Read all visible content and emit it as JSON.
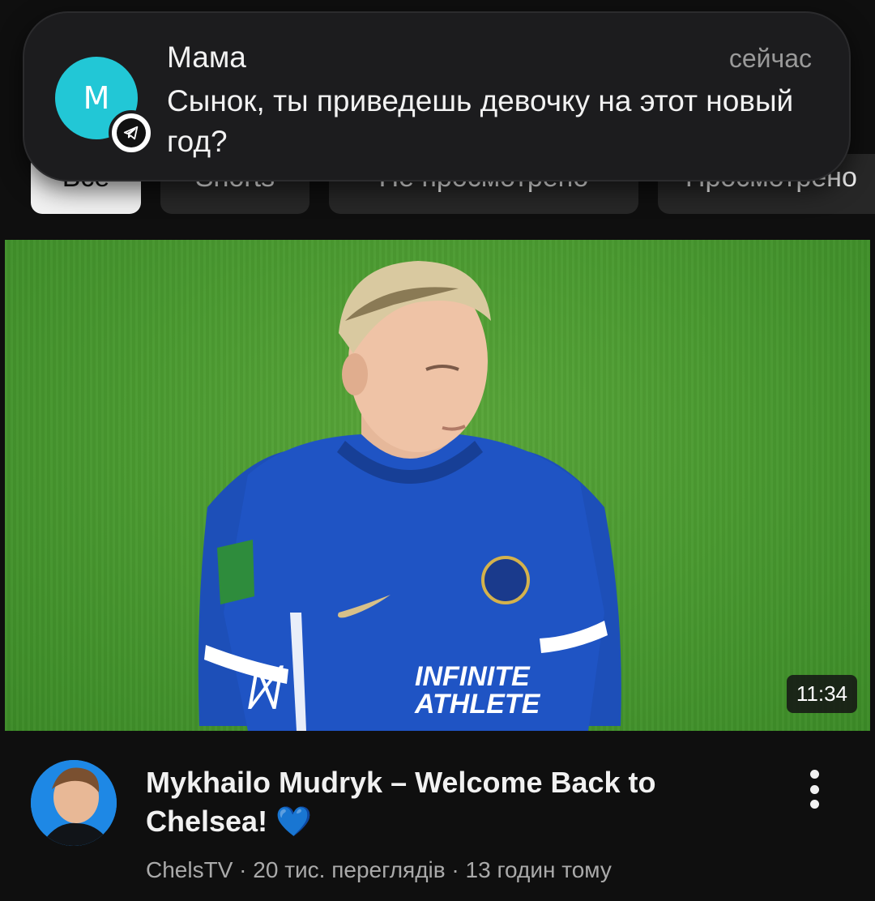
{
  "chips": [
    {
      "label": "Все",
      "active": true
    },
    {
      "label": "Shorts",
      "active": false
    },
    {
      "label": "Не просмотрено",
      "active": false
    },
    {
      "label": "Просмотрено",
      "active": false
    }
  ],
  "notification": {
    "app_icon": "telegram-icon",
    "avatar_letter": "М",
    "avatar_color": "#22c7d6",
    "sender": "Мама",
    "time": "сейчас",
    "message": "Сынок, ты приведешь девочку на этот новый год?"
  },
  "video": {
    "duration": "11:34",
    "title": "Mykhailo Mudryk – Welcome Back to Chelsea! 💙",
    "channel": "ChelsTV",
    "views": "20 тис. переглядів",
    "age": "13 годин тому",
    "separator": "·",
    "thumbnail_shirt_text": "INFINITE ATHLETE"
  },
  "colors": {
    "background": "#0f0f0f",
    "chip_active": "#f1f1f1",
    "chip": "#272727",
    "pitch": "#4a9a30",
    "kit": "#1d4fb8"
  }
}
